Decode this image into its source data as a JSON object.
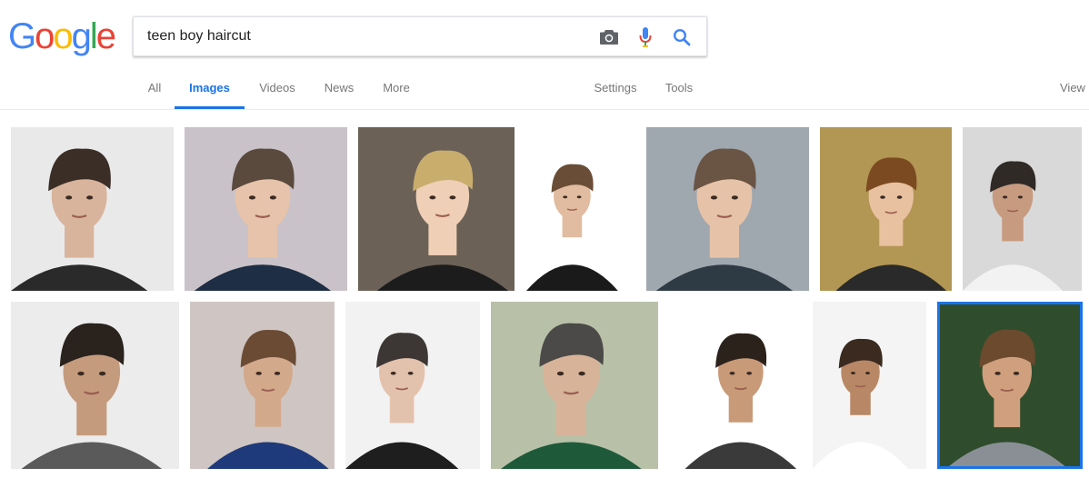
{
  "logo": {
    "letters": [
      "G",
      "o",
      "o",
      "g",
      "l",
      "e"
    ],
    "colors": [
      "#4285F4",
      "#EA4335",
      "#FBBC05",
      "#4285F4",
      "#34A853",
      "#EA4335"
    ]
  },
  "search": {
    "query": "teen boy haircut"
  },
  "icons": {
    "camera": "camera-icon",
    "mic": "microphone-icon",
    "search": "search-icon"
  },
  "tabs": {
    "all": "All",
    "images": "Images",
    "videos": "Videos",
    "news": "News",
    "more": "More",
    "settings": "Settings",
    "tools": "Tools",
    "view": "View"
  },
  "colors": {
    "accent": "#1a73e8",
    "tab_text": "#777777"
  },
  "results": {
    "row1": [
      {
        "bg": "#e9e9ea",
        "hair": "#3a2e27",
        "skin": "#d8b49c",
        "shirt": "#2a2a2a"
      },
      {
        "bg": "#c9c2c8",
        "hair": "#5a4a3e",
        "skin": "#e6c3aa",
        "shirt": "#1e2e44"
      },
      {
        "bg": "#6b6157",
        "hair": "#c8ad6d",
        "skin": "#efcfb6",
        "shirt": "#1c1c1c"
      },
      {
        "bg": "#ffffff",
        "hair": "#6a4d36",
        "skin": "#e1bca0",
        "shirt": "#1a1a1a"
      },
      {
        "bg": "#9fa7af",
        "hair": "#6a5444",
        "skin": "#e6c3a8",
        "shirt": "#2e3a44"
      },
      {
        "bg": "#b29654",
        "hair": "#7b4a20",
        "skin": "#e8c1a0",
        "shirt": "#2a2a2a"
      },
      {
        "bg": "#d9d9d9",
        "hair": "#2f2a26",
        "skin": "#c69b80",
        "shirt": "#f2f2f2"
      }
    ],
    "row2": [
      {
        "bg": "#ececec",
        "hair": "#2a221d",
        "skin": "#c59b7e",
        "shirt": "#5a5a5a"
      },
      {
        "bg": "#cfc6c3",
        "hair": "#6b4b34",
        "skin": "#d3a98c",
        "shirt": "#1e3a7a"
      },
      {
        "bg": "#f2f2f2",
        "hair": "#3c3634",
        "skin": "#e3c2ad",
        "shirt": "#1e1e1e"
      },
      {
        "bg": "#b8c1a8",
        "hair": "#4c4a48",
        "skin": "#d7b39a",
        "shirt": "#1e5a3a"
      },
      {
        "bg": "#ffffff",
        "hair": "#2c221c",
        "skin": "#c99a78",
        "shirt": "#3a3a3a"
      },
      {
        "bg": "#f4f4f4",
        "hair": "#3a2a20",
        "skin": "#b88866",
        "shirt": "#ffffff"
      },
      {
        "bg": "#2f4d2c",
        "hair": "#6b4a2e",
        "skin": "#d0a07e",
        "shirt": "#8a8f96"
      }
    ]
  }
}
